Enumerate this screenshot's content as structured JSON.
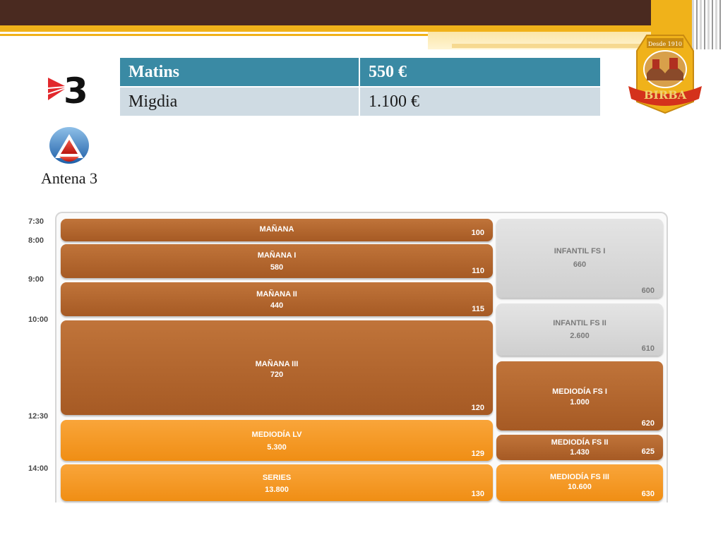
{
  "prices": {
    "header": {
      "slot": "Matins",
      "price": "550 €"
    },
    "rows": [
      {
        "slot": "Migdia",
        "price": "1.100 €"
      }
    ]
  },
  "logos": {
    "tv3": "tv3-logo",
    "antena3": {
      "name": "Antena 3"
    },
    "birba": {
      "tagline": "Desde 1910",
      "name": "BIRBA"
    }
  },
  "schedule": {
    "times": [
      "7:30",
      "8:00",
      "9:00",
      "10:00",
      "12:30",
      "14:00"
    ],
    "left_blocks": [
      {
        "name": "MAÑANA",
        "value": "",
        "code": "100"
      },
      {
        "name": "MAÑANA I",
        "value": "580",
        "code": "110"
      },
      {
        "name": "MAÑANA II",
        "value": "440",
        "code": "115"
      },
      {
        "name": "MAÑANA III",
        "value": "720",
        "code": "120"
      },
      {
        "name": "MEDIODÍA LV",
        "value": "5.300",
        "code": "129"
      },
      {
        "name": "SERIES",
        "value": "13.800",
        "code": "130"
      }
    ],
    "right_blocks": [
      {
        "name": "INFANTIL FS I",
        "value": "660",
        "code": "600"
      },
      {
        "name": "INFANTIL FS II",
        "value": "2.600",
        "code": "610"
      },
      {
        "name": "MEDIODÍA FS I",
        "value": "1.000",
        "code": "620"
      },
      {
        "name": "MEDIODÍA FS II",
        "value": "1.430",
        "code": "625"
      },
      {
        "name": "MEDIODÍA FS III",
        "value": "10.600",
        "code": "630"
      }
    ]
  },
  "colors": {
    "header_brown": "#4a2a20",
    "gold": "#f0b21a",
    "table_header": "#3a8aa4",
    "table_row": "#cfdbe3",
    "block_brown": "#a65a24",
    "block_orange": "#f08e14",
    "block_grey": "#d8d8d8"
  }
}
